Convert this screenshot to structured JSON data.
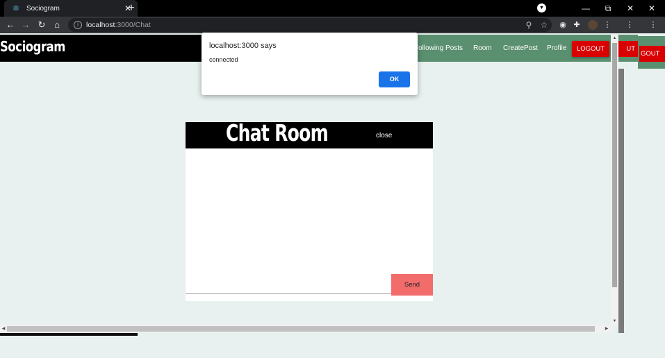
{
  "browser": {
    "tab_title": "Sociogram",
    "tab_close": "✕",
    "new_tab": "+",
    "url_host": "localhost",
    "url_path": ":3000/Chat",
    "window_controls": [
      "—",
      "❐",
      "✕"
    ],
    "icons": [
      "back-icon",
      "forward-icon",
      "reload-icon",
      "home-icon",
      "info-icon",
      "zoom-icon",
      "star-icon",
      "extensions-icon",
      "menu-icon"
    ]
  },
  "site": {
    "brand": "Sociogram",
    "nav_links": [
      "Following Posts",
      "Room",
      "CreatePost",
      "Profile"
    ],
    "logout_label": "LOGOUT",
    "artifact_label_1": "UT",
    "artifact_label_2": "GOUT"
  },
  "dialog": {
    "title": "localhost:3000 says",
    "message": "connected",
    "ok_label": "OK"
  },
  "chat": {
    "title": "Chat Room",
    "close_label": "close",
    "input_value": "",
    "send_label": "Send"
  },
  "colors": {
    "nav_green": "#5a8f6f",
    "logout_red": "#d80000",
    "send_button": "#f26c6c",
    "page_bg": "#e8f1ef",
    "dialog_ok": "#1a73e8"
  }
}
